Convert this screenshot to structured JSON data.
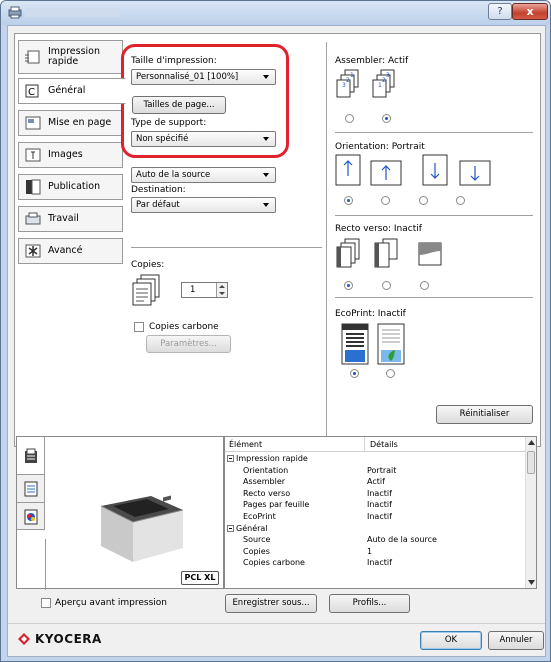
{
  "titlebar": {
    "help_label": "?",
    "close_label": "x"
  },
  "tabs": [
    {
      "label": "Impression rapide",
      "line1": "Impression",
      "line2": "rapide"
    },
    {
      "label": "Général"
    },
    {
      "label": "Mise en page"
    },
    {
      "label": "Images"
    },
    {
      "label": "Publication"
    },
    {
      "label": "Travail"
    },
    {
      "label": "Avancé"
    }
  ],
  "general": {
    "print_size_label": "Taille d'impression:",
    "print_size_value": "Personnalisé_01 [100%]",
    "page_sizes_button": "Tailles de page...",
    "media_type_label": "Type de support:",
    "media_type_value": "Non spécifié",
    "source_value": "Auto de la source",
    "destination_label": "Destination:",
    "destination_value": "Par défaut",
    "copies_label": "Copies:",
    "copies_value": "1",
    "carbon_copies_label": "Copies carbone",
    "settings_button": "Paramètres...",
    "collate_label": "Assembler: Actif",
    "orientation_label": "Orientation: Portrait",
    "duplex_label": "Recto verso: Inactif",
    "ecoprint_label": "EcoPrint: Inactif",
    "reset_button": "Réinitialiser"
  },
  "preview": {
    "badge": "PCL XL",
    "checkbox_label": "Aperçu avant impression"
  },
  "table": {
    "col_element": "Élément",
    "col_details": "Détails",
    "rows": [
      {
        "element": "Impression rapide",
        "details": "",
        "group": true
      },
      {
        "element": "Orientation",
        "details": "Portrait"
      },
      {
        "element": "Assembler",
        "details": "Actif"
      },
      {
        "element": "Recto verso",
        "details": "Inactif"
      },
      {
        "element": "Pages par feuille",
        "details": "Inactif"
      },
      {
        "element": "EcoPrint",
        "details": "Inactif"
      },
      {
        "element": "Général",
        "details": "",
        "group": true
      },
      {
        "element": "Source",
        "details": "Auto de la source"
      },
      {
        "element": "Copies",
        "details": "1"
      },
      {
        "element": "Copies carbone",
        "details": "Inactif"
      }
    ]
  },
  "footer": {
    "save_as_button": "Enregistrer sous...",
    "profiles_button": "Profils...",
    "brand": "KYOCERA",
    "ok_button": "OK",
    "cancel_button": "Annuler"
  },
  "colors": {
    "accent_blue": "#1f57c4",
    "highlight_red": "#e0222d",
    "brand_red": "#d7232b",
    "ecoprint_green": "#29a12c"
  }
}
